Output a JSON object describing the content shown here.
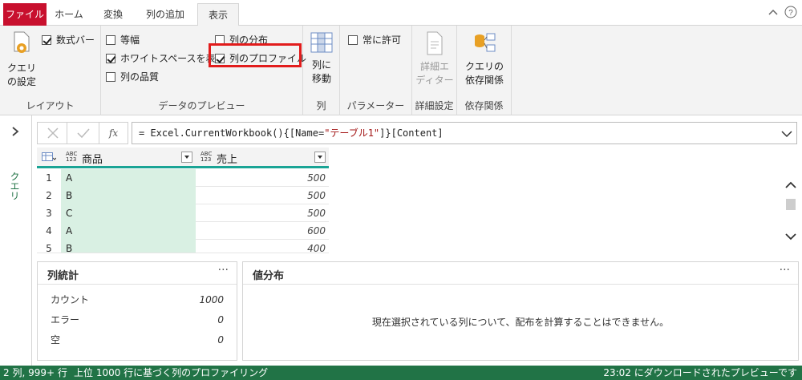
{
  "tabs": [
    {
      "label": "ファイル"
    },
    {
      "label": "ホーム"
    },
    {
      "label": "変換"
    },
    {
      "label": "列の追加"
    },
    {
      "label": "表示"
    }
  ],
  "ribbon": {
    "layout": {
      "query_settings": "クエリ",
      "query_settings_2": "の設定",
      "formula_bar": "数式バー",
      "label": "レイアウト"
    },
    "preview": {
      "monospace": "等幅",
      "whitespace": "ホワイトスペースを表示",
      "quality": "列の品質",
      "distribution": "列の分布",
      "profile": "列のプロファイル",
      "label": "データのプレビュー"
    },
    "column": {
      "goto_1": "列に",
      "goto_2": "移動",
      "label": "列"
    },
    "params": {
      "always_allow": "常に許可",
      "label": "パラメーター"
    },
    "advanced": {
      "editor_1": "詳細エ",
      "editor_2": "ディター",
      "label": "詳細設定"
    },
    "deps": {
      "btn_1": "クエリの",
      "btn_2": "依存関係",
      "label": "依存関係"
    }
  },
  "left_pane": {
    "label": "クエリ"
  },
  "formula": {
    "prefix": "= Excel.CurrentWorkbook(){[Name=",
    "string": "\"テーブル1\"",
    "suffix": "]}[Content]",
    "fx": "fx"
  },
  "grid": {
    "columns": [
      {
        "name": "商品",
        "type": "ABC 123"
      },
      {
        "name": "売上",
        "type": "ABC 123"
      }
    ],
    "rows": [
      {
        "n": "1",
        "product": "A",
        "sales": "500"
      },
      {
        "n": "2",
        "product": "B",
        "sales": "500"
      },
      {
        "n": "3",
        "product": "C",
        "sales": "500"
      },
      {
        "n": "4",
        "product": "A",
        "sales": "600"
      },
      {
        "n": "5",
        "product": "B",
        "sales": "400"
      }
    ]
  },
  "stats_panel": {
    "title": "列統計",
    "dots": "···",
    "items": [
      {
        "label": "カウント",
        "value": "1000"
      },
      {
        "label": "エラー",
        "value": "0"
      },
      {
        "label": "空",
        "value": "0"
      }
    ]
  },
  "dist_panel": {
    "title": "値分布",
    "dots": "···",
    "message": "現在選択されている列について、配布を計算することはできません。"
  },
  "status": {
    "left": "2 列, 999+ 行",
    "middle": "上位 1000 行に基づく列のプロファイリング",
    "right": "23:02 にダウンロードされたプレビューです"
  },
  "colors": {
    "brand_green": "#217346",
    "file_red": "#c8102e",
    "accent_teal": "#1aa495",
    "highlight_red": "#e21c1c"
  }
}
